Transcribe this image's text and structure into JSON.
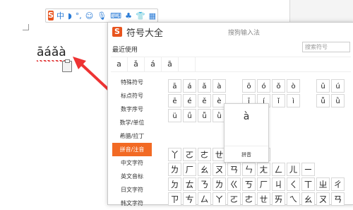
{
  "ime_bar": {
    "logo": "S",
    "items": [
      "中",
      "◗",
      "°,",
      "☺",
      "🎙",
      "⌨",
      "♣",
      "👕",
      "▦"
    ]
  },
  "document": {
    "text": "āáǎà"
  },
  "symbol_window": {
    "title": "符号大全",
    "search_label": "搜狗输入法",
    "search_placeholder": "搜索符号",
    "recent_label": "最近使用",
    "recent_items": [
      "a",
      "ǎ",
      "á",
      "ā",
      ""
    ],
    "sidebar": [
      {
        "label": "特殊符号",
        "active": false
      },
      {
        "label": "标点符号",
        "active": false
      },
      {
        "label": "数字序号",
        "active": false
      },
      {
        "label": "数学/单位",
        "active": false
      },
      {
        "label": "希腊/拉丁",
        "active": false
      },
      {
        "label": "拼音/注音",
        "active": true
      },
      {
        "label": "中文字符",
        "active": false
      },
      {
        "label": "英文音标",
        "active": false
      },
      {
        "label": "日文字符",
        "active": false
      },
      {
        "label": "韩文字符",
        "active": false
      }
    ],
    "pinyin_rows": [
      [
        "ā",
        "á",
        "ǎ",
        "à",
        "",
        "ō",
        "ó",
        "ǒ",
        "ò",
        "",
        "ū",
        "ú"
      ],
      [
        "ē",
        "é",
        "ě",
        "è",
        "",
        "ī",
        "í",
        "ǐ",
        "ì",
        "",
        "ǚ",
        "ǜ"
      ],
      [
        "ü",
        "ǘ",
        "ǚ",
        "ǜ",
        "",
        "",
        "",
        "",
        "",
        "",
        "",
        ""
      ]
    ],
    "bopomofo_rows": [
      [
        "丫",
        "ㄛ",
        "ㄜ",
        "ㄝ",
        "ㄞ",
        "ㄟ",
        "ㄠ",
        "",
        "",
        "",
        "",
        ""
      ],
      [
        "ㄌ",
        "ㄏ",
        "ㄠ",
        "ㄡ",
        "ㄢ",
        "ㄣ",
        "ㄤ",
        "ㄥ",
        "ㄦ",
        "ㄧ",
        "",
        ""
      ],
      [
        "ㄉ",
        "ㄊ",
        "ㄋ",
        "ㄌ",
        "ㄍ",
        "ㄎ",
        "ㄏ",
        "ㄐ",
        "ㄑ",
        "ㄒ",
        "ㄓ",
        "ㄔ"
      ],
      [
        "ㄗ",
        "ㄘ",
        "ㄙ",
        "ㄚ",
        "ㄛ",
        "ㄜ",
        "ㄝ",
        "ㄞ",
        "ㄟ",
        "ㄠ",
        "ㄡ",
        "ㄢ"
      ]
    ],
    "popup": {
      "char": "à",
      "label": "拼音"
    }
  }
}
